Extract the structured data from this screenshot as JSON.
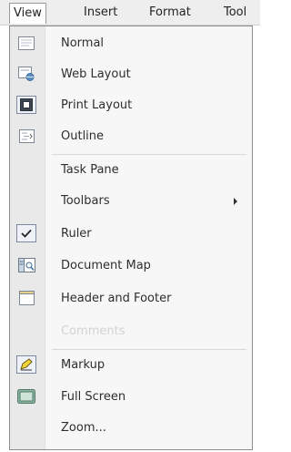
{
  "menubar": {
    "items": [
      {
        "label": "View"
      },
      {
        "label": "Insert"
      },
      {
        "label": "Format"
      },
      {
        "label": "Tool"
      }
    ]
  },
  "menu": {
    "items": [
      {
        "label": "Normal",
        "icon": "normal-view-icon"
      },
      {
        "label": "Web Layout",
        "icon": "web-layout-icon"
      },
      {
        "label": "Print Layout",
        "icon": "print-layout-icon",
        "checked": true
      },
      {
        "label": "Outline",
        "icon": "outline-view-icon"
      },
      {
        "label": "Task Pane"
      },
      {
        "label": "Toolbars",
        "submenu": true
      },
      {
        "label": "Ruler",
        "icon": "checkmark-icon",
        "checked": true
      },
      {
        "label": "Document Map",
        "icon": "document-map-icon"
      },
      {
        "label": "Header and Footer",
        "icon": "header-footer-icon"
      },
      {
        "label": "Comments",
        "disabled": true
      },
      {
        "label": "Markup",
        "icon": "markup-icon",
        "checked": true
      },
      {
        "label": "Full Screen",
        "icon": "full-screen-icon"
      },
      {
        "label": "Zoom..."
      }
    ]
  },
  "colors": {
    "menubar_bg": "#eeeeee",
    "menu_bg": "#f7f7f7",
    "icon_column_bg": "#e9e9e9",
    "checked_border": "#7f8aa0",
    "disabled_text": "#d3d3d3"
  }
}
